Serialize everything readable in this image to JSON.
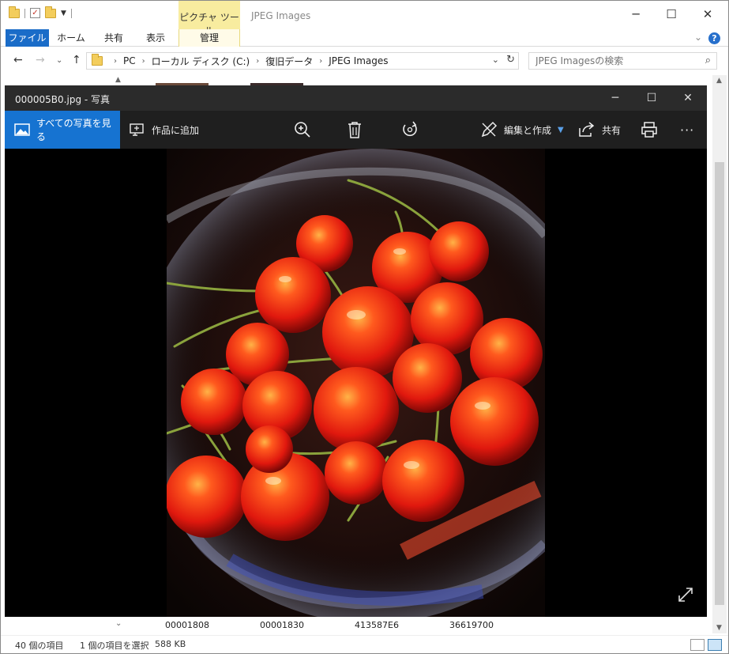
{
  "explorer": {
    "window_title": "JPEG Images",
    "context_tab": "ピクチャ ツール",
    "ribbon_tabs": [
      {
        "label": "ファイル"
      },
      {
        "label": "ホーム"
      },
      {
        "label": "共有"
      },
      {
        "label": "表示"
      },
      {
        "label": "管理"
      }
    ],
    "breadcrumb": [
      "PC",
      "ローカル ディスク (C:)",
      "復旧データ",
      "JPEG Images"
    ],
    "search_placeholder": "JPEG Imagesの検索",
    "file_labels": [
      "00001808",
      "00001830",
      "413587E6",
      "36619700"
    ],
    "status": {
      "item_count": "40 個の項目",
      "selection": "1 個の項目を選択",
      "size": "588 KB"
    }
  },
  "photos_app": {
    "title": "000005B0.jpg - 写真",
    "see_all_label": "すべての写真を見る",
    "add_to_creation_label": "作品に追加",
    "edit_create_label": "編集と作成",
    "share_label": "共有",
    "accent_color": "#1673d1",
    "photo_subject": "cherries in glass bowl"
  }
}
